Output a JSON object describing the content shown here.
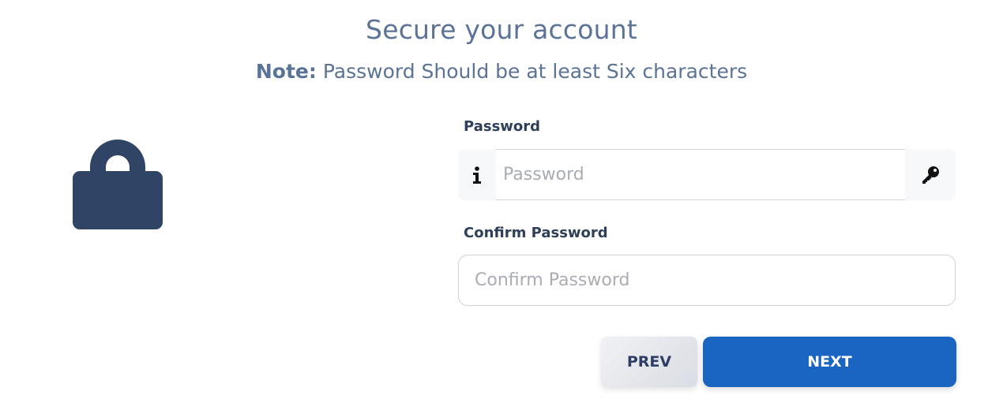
{
  "header": {
    "title": "Secure your account",
    "note_label": "Note:",
    "note_text": " Password Should be at least Six characters"
  },
  "form": {
    "password": {
      "label": "Password",
      "placeholder": "Password",
      "left_icon": "info-icon",
      "right_icon": "key-icon"
    },
    "confirm": {
      "label": "Confirm Password",
      "placeholder": "Confirm Password"
    }
  },
  "buttons": {
    "prev": "PREV",
    "next": "NEXT"
  },
  "icons": {
    "lock": "lock-icon"
  },
  "colors": {
    "title": "#5b7396",
    "label": "#2e3f59",
    "lock": "#304566",
    "primary": "#1a64c2"
  }
}
